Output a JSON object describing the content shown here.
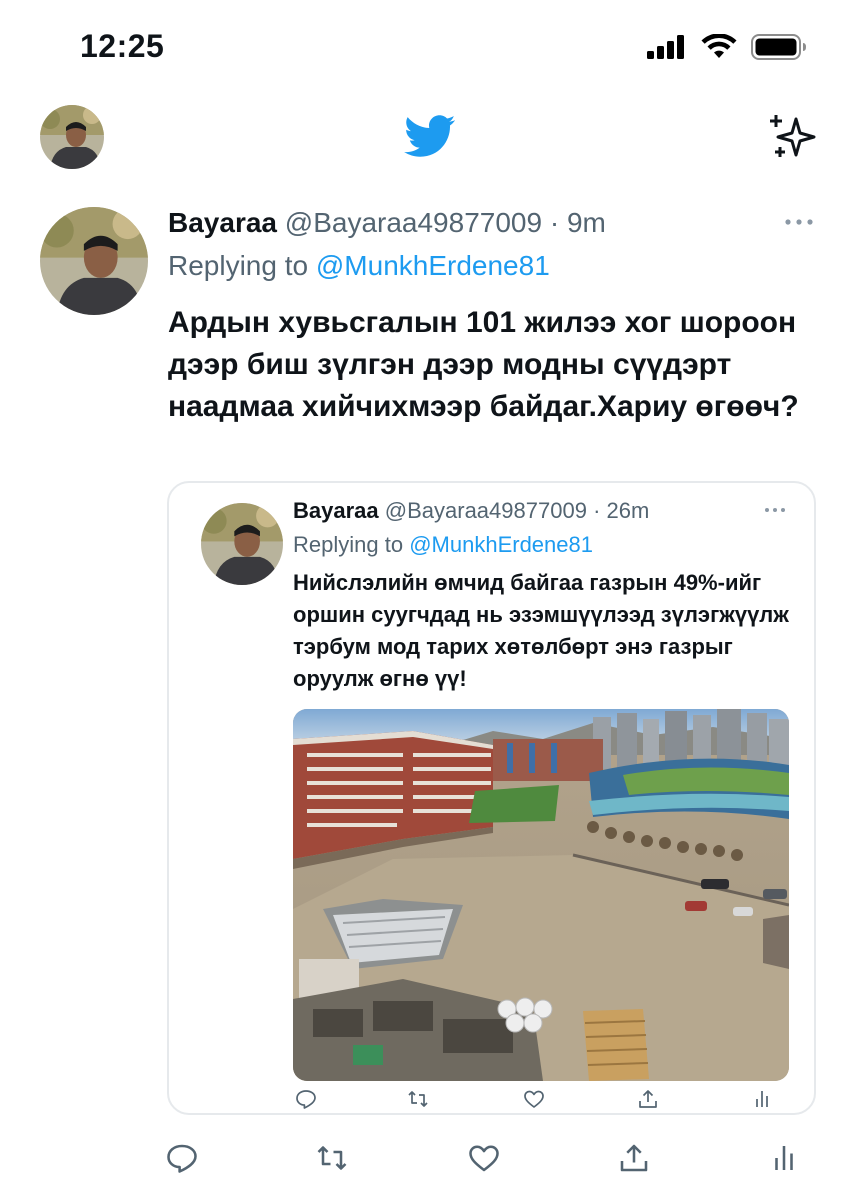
{
  "status_bar": {
    "time": "12:25"
  },
  "top_nav": {
    "logo_icon": "twitter-bird-icon",
    "sparkle_icon": "sparkle-icon",
    "brand_color": "#1d9bf0"
  },
  "tweet": {
    "display_name": "Bayaraa",
    "handle": "@Bayaraa49877009",
    "separator": "·",
    "time": "9m",
    "replying_label": "Replying to",
    "replying_handle": "@MunkhErdene81",
    "text": "Ардын хувьсгалын 101 жилээ хог шороон дээр биш зүлгэн дээр модны сүүдэрт наадмаа хийчихмээр байдаг.Хариу өгөөч?",
    "quote": {
      "display_name": "Bayaraa",
      "handle": "@Bayaraa49877009",
      "separator": "·",
      "time": "26m",
      "replying_label": "Replying to",
      "replying_handle": "@MunkhErdene81",
      "text": "Нийслэлийн өмчид байгаа газрын 49%-ийг оршин суугчдад нь эзэмшүүлээд зүлэгжүүлж тэрбум мод тарих хөтөлбөрт энэ газрыг оруулж өгнө үү!",
      "actions": [
        "reply-icon",
        "retweet-icon",
        "like-icon",
        "share-icon",
        "analytics-icon"
      ]
    },
    "actions": [
      "reply-icon",
      "retweet-icon",
      "like-icon",
      "share-icon",
      "analytics-icon"
    ]
  },
  "colors": {
    "text_primary": "#0f1419",
    "text_secondary": "#536471",
    "link": "#1d9bf0",
    "border": "#e6e9ec"
  }
}
